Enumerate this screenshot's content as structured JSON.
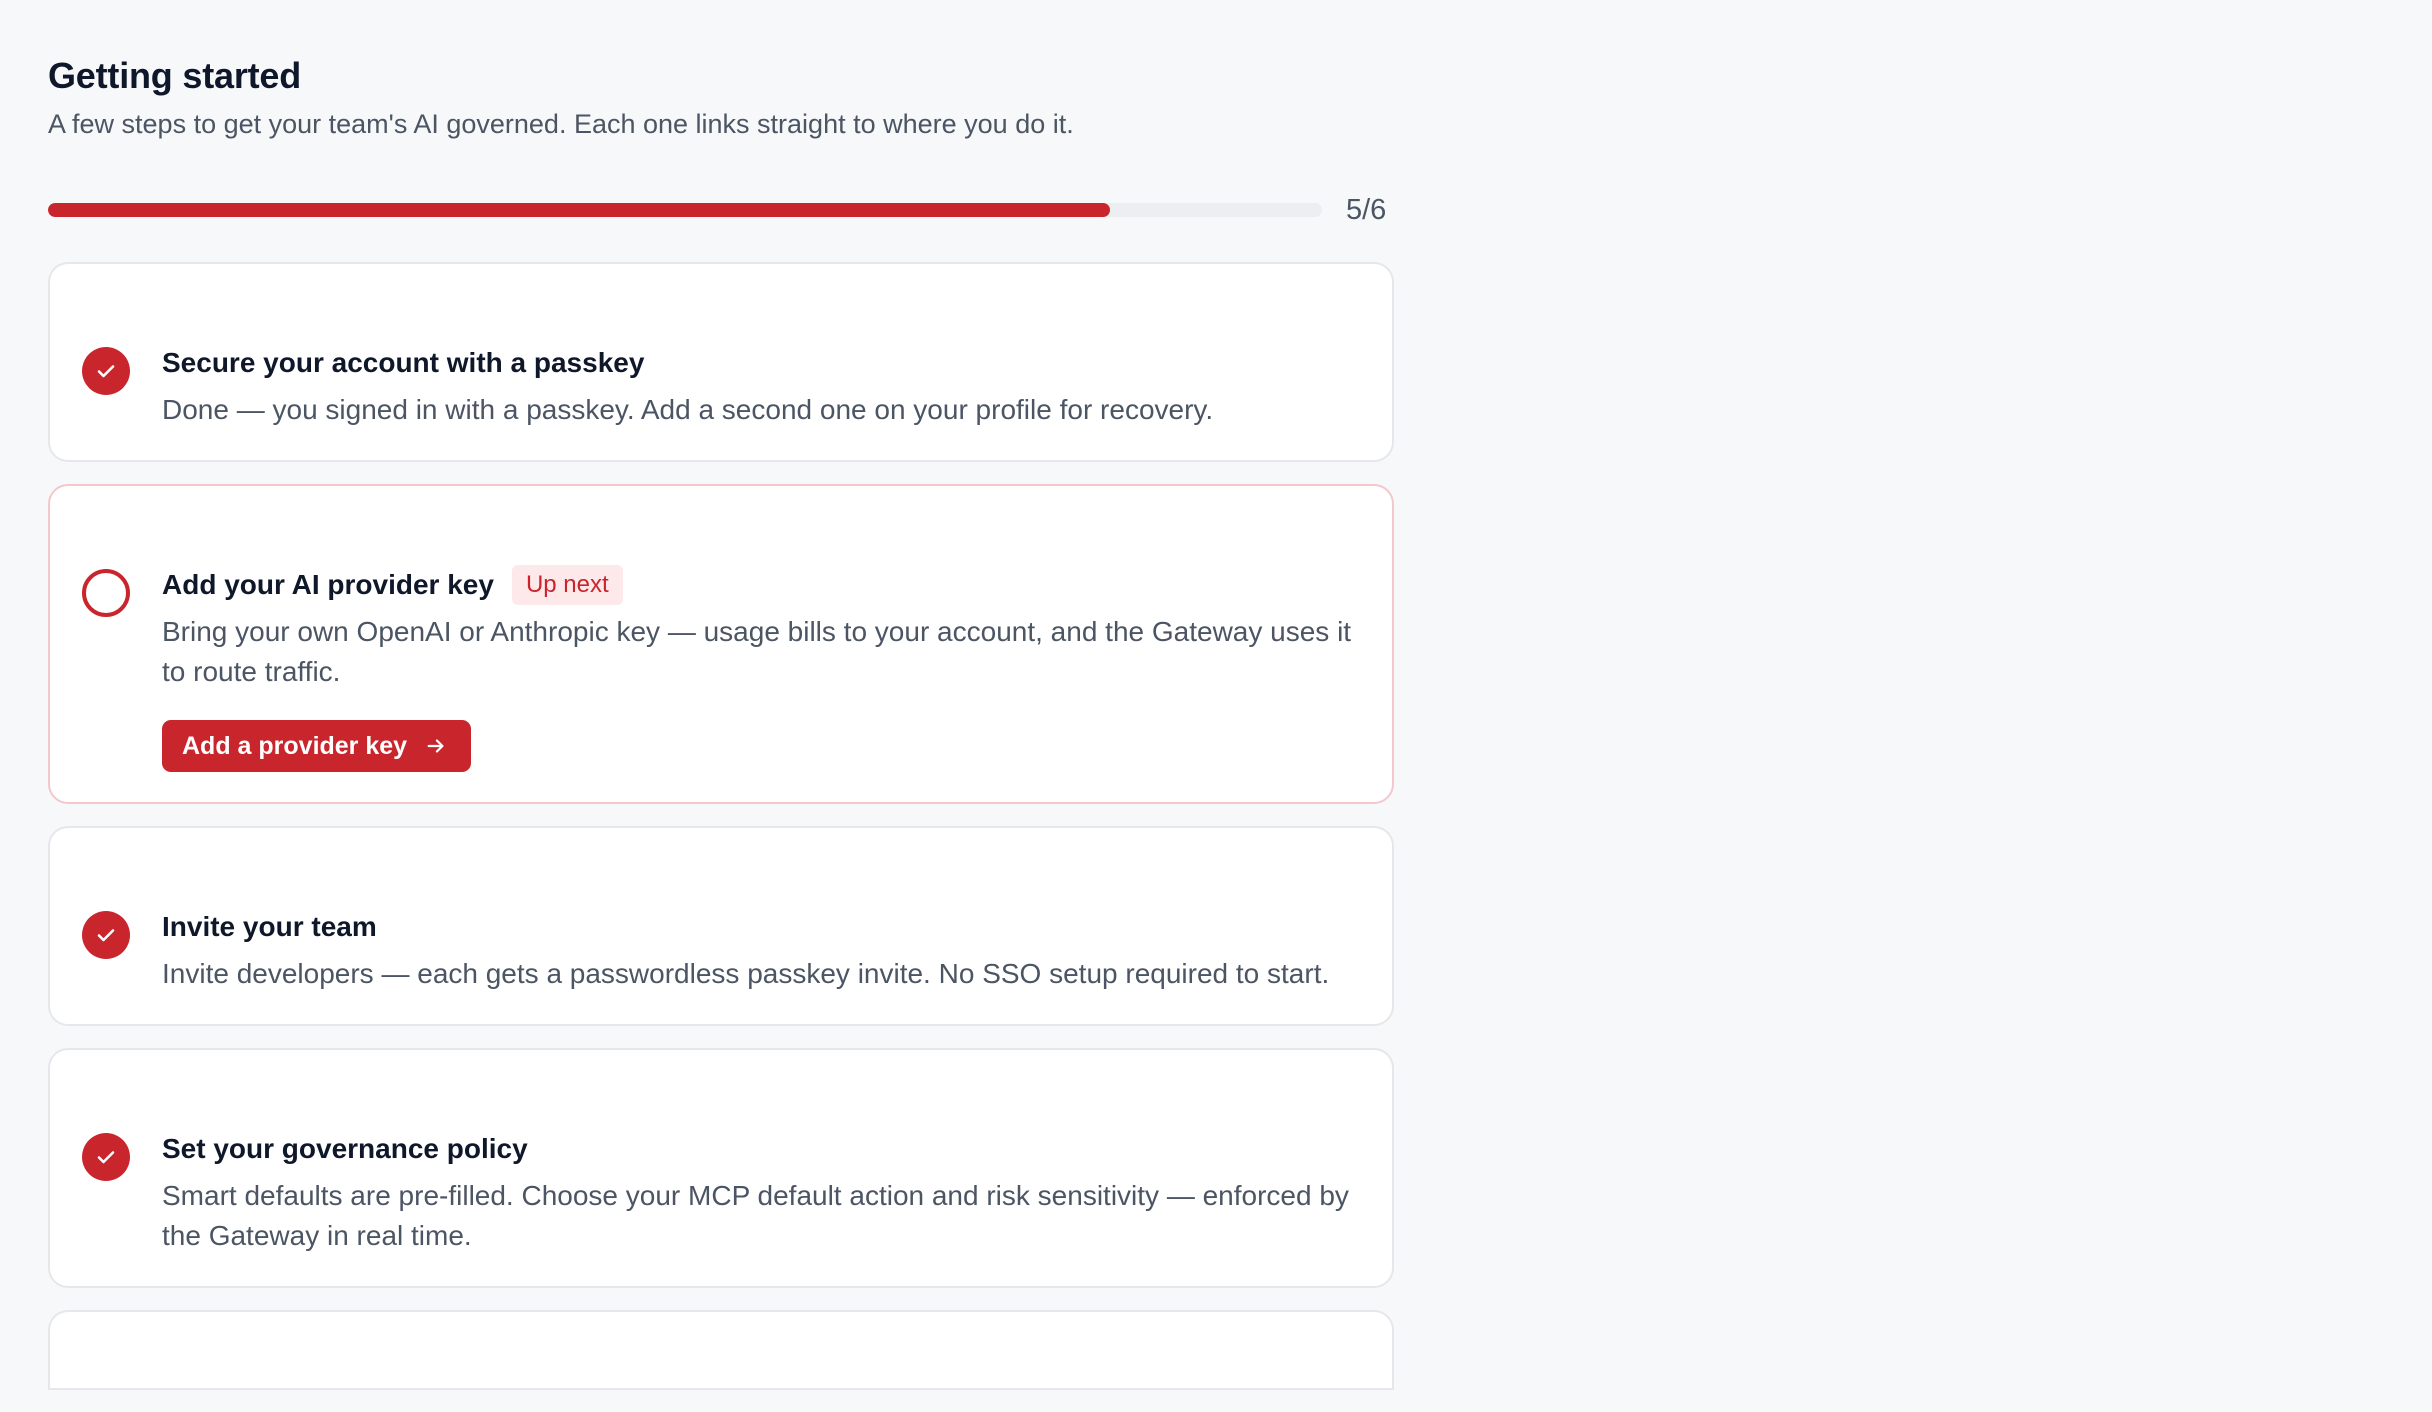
{
  "header": {
    "title": "Getting started",
    "subtitle": "A few steps to get your team's AI governed. Each one links straight to where you do it."
  },
  "progress": {
    "completed": 5,
    "total": 6,
    "label": "5/6",
    "color": "#c9252c"
  },
  "steps": [
    {
      "title": "Secure your account with a passkey",
      "description": "Done — you signed in with a passkey. Add a second one on your profile for recovery.",
      "status": "done",
      "icon": "check-circle-icon"
    },
    {
      "title": "Add your AI provider key",
      "badge": "Up next",
      "description": "Bring your own OpenAI or Anthropic key — usage bills to your account, and the Gateway uses it to route traffic.",
      "action_label": "Add a provider key",
      "action_icon": "arrow-right-icon",
      "status": "pending",
      "icon": "empty-circle-icon"
    },
    {
      "title": "Invite your team",
      "description": "Invite developers — each gets a passwordless passkey invite. No SSO setup required to start.",
      "status": "done",
      "icon": "check-circle-icon"
    },
    {
      "title": "Set your governance policy",
      "description": "Smart defaults are pre-filled. Choose your MCP default action and risk sensitivity — enforced by the Gateway in real time.",
      "status": "done",
      "icon": "check-circle-icon"
    }
  ]
}
